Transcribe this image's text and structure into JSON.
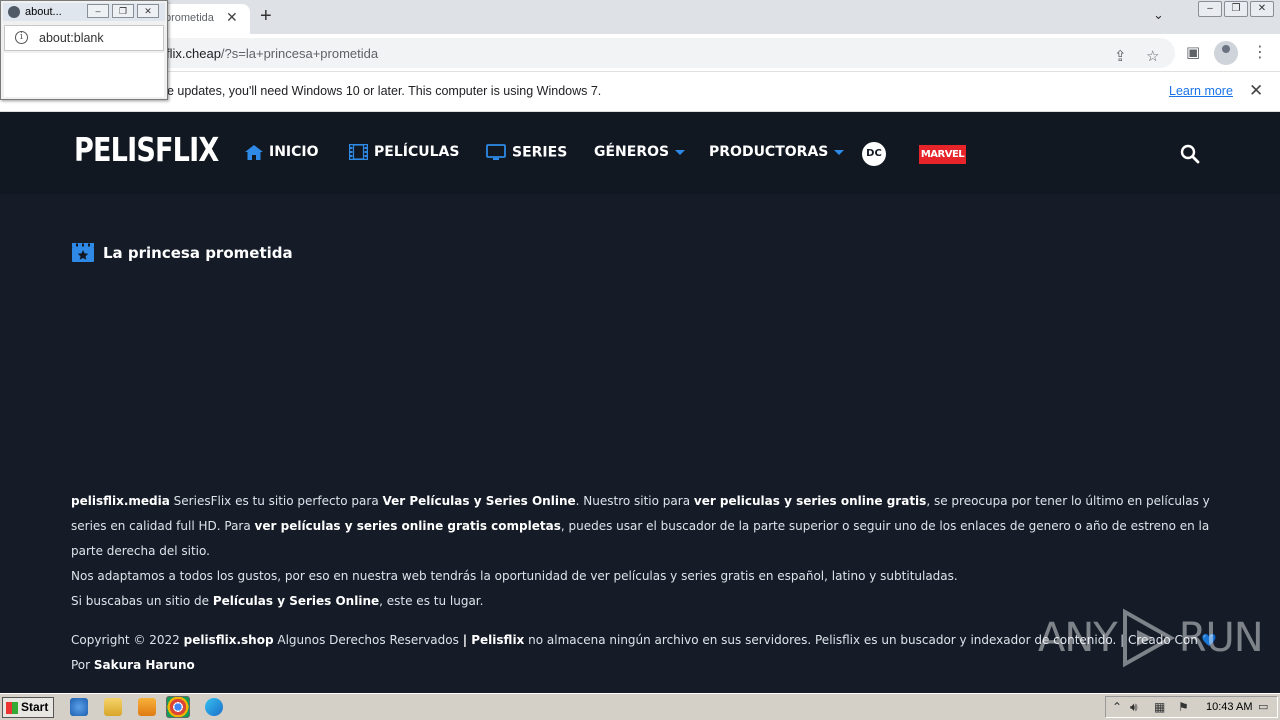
{
  "browser": {
    "tab_title": "prometida",
    "url_host": "flix.cheap",
    "url_path": "/?s=la+princesa+prometida",
    "infobar_text": "he updates, you'll need Windows 10 or later. This computer is using Windows 7.",
    "infobar_link": "Learn more"
  },
  "popup": {
    "title": "about...",
    "url": "about:blank"
  },
  "site": {
    "logo": "PELISFLIX",
    "nav": {
      "inicio": "INICIO",
      "peliculas": "PELÍCULAS",
      "series": "SERIES",
      "generos": "GÉNEROS",
      "productoras": "PRODUCTORAS",
      "dc": "DC",
      "marvel": "MARVEL"
    },
    "accent_color": "#2e8ae6"
  },
  "main": {
    "heading": "La princesa prometida"
  },
  "footer": {
    "p1": {
      "site": "pelisflix.media",
      "t1": " SeriesFlix es tu sitio perfecto para ",
      "b1": "Ver Películas y Series Online",
      "t2": ". Nuestro sitio para ",
      "b2": "ver peliculas y series online gratis",
      "t3": ", se preocupa por tener lo último en películas y series en calidad full HD. Para ",
      "b3": "ver películas y series online gratis completas",
      "t4": ", puedes usar el buscador de la parte superior o seguir uno de los enlaces de genero o año de estreno en la parte derecha del sitio."
    },
    "p2": "Nos adaptamos a todos los gustos, por eso en nuestra web tendrás la oportunidad de ver películas y series gratis en español, latino y subtituladas.",
    "p3": {
      "t1": "Si buscabas un sitio de ",
      "b1": "Películas y Series Online",
      "t2": ", este es tu lugar."
    },
    "copyright": {
      "t1": "Copyright © 2022 ",
      "b1": "pelisflix.shop",
      "t2": " Algunos Derechos Reservados ",
      "b2": "| Pelisflix",
      "t3": " no almacena ningún archivo en sus servidores. Pelisflix es un buscador y indexador de contenido. | Creado Con ",
      "heart": "💙",
      "t4": " Por ",
      "b3": "Sakura Haruno"
    }
  },
  "watermark": {
    "left": "ANY",
    "right": "RUN"
  },
  "taskbar": {
    "start": "Start",
    "clock": "10:43 AM"
  }
}
